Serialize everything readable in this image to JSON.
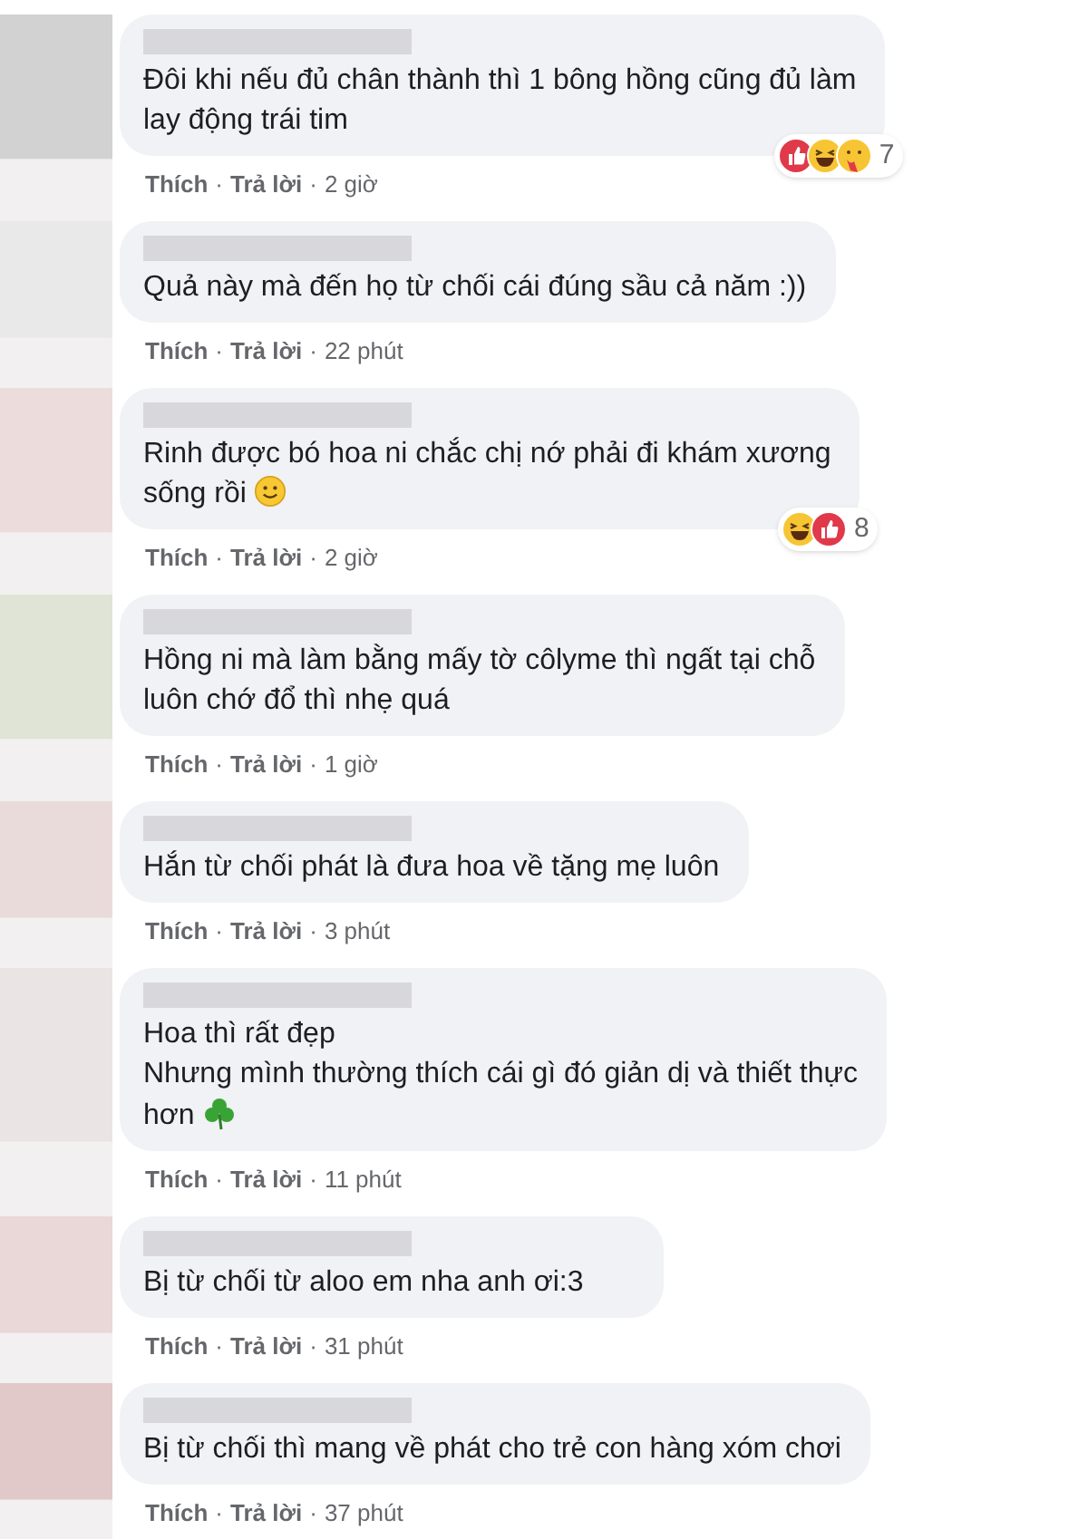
{
  "separator": "·",
  "comments": [
    {
      "lines": [
        "Đôi khi nếu đủ chân thành thì 1 bông hồng cũng đủ làm",
        "lay động trái tim"
      ],
      "like": "Thích",
      "reply": "Trả lời",
      "time": "2 giờ",
      "reactions": {
        "types": [
          {
            "kind": "like"
          },
          {
            "kind": "haha"
          },
          {
            "kind": "care"
          }
        ],
        "count": "7"
      }
    },
    {
      "lines": [
        "Quả này mà đến họ từ chối cái đúng sầu cả năm :))"
      ],
      "like": "Thích",
      "reply": "Trả lời",
      "time": "22 phút"
    },
    {
      "lines": [
        "Rinh được bó hoa ni chắc chị nớ phải đi khám xương",
        "sống rồi"
      ],
      "emoji": {
        "kind": "smiley"
      },
      "like": "Thích",
      "reply": "Trả lời",
      "time": "2 giờ",
      "reactions": {
        "types": [
          {
            "kind": "haha"
          },
          {
            "kind": "like"
          }
        ],
        "count": "8"
      }
    },
    {
      "lines": [
        "Hồng ni mà làm bằng mấy tờ côlyme thì ngất tại chỗ",
        "luôn chớ đổ thì nhẹ quá"
      ],
      "like": "Thích",
      "reply": "Trả lời",
      "time": "1 giờ"
    },
    {
      "lines": [
        "Hắn từ chối phát là đưa hoa về tặng mẹ luôn"
      ],
      "like": "Thích",
      "reply": "Trả lời",
      "time": "3 phút"
    },
    {
      "lines": [
        "Hoa thì rất đẹp",
        "Nhưng mình thường thích cái gì đó giản dị và thiết thực",
        "hơn"
      ],
      "emoji": {
        "kind": "clover"
      },
      "like": "Thích",
      "reply": "Trả lời",
      "time": "11 phút"
    },
    {
      "lines": [
        "Bị từ chối từ aloo em nha anh ơi:3"
      ],
      "like": "Thích",
      "reply": "Trả lời",
      "time": "31 phút"
    },
    {
      "lines": [
        "Bị từ chối thì mang về phát cho trẻ con hàng xóm chơi"
      ],
      "like": "Thích",
      "reply": "Trả lời",
      "time": "37 phút"
    }
  ]
}
